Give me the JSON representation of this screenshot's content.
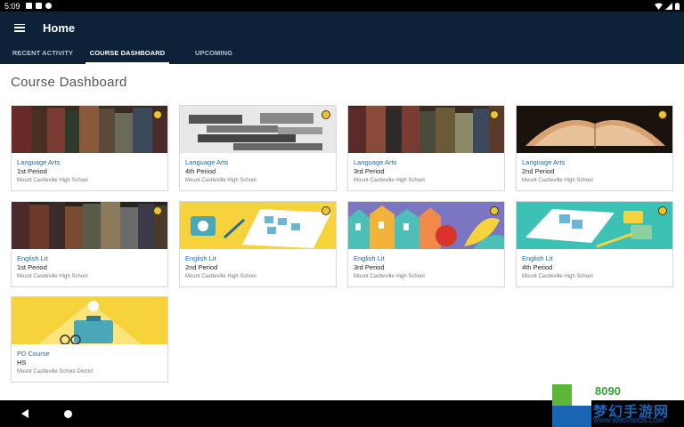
{
  "status_bar": {
    "time": "5:09"
  },
  "app_bar": {
    "title": "Home",
    "menu_icon": "hamburger-menu-icon"
  },
  "tabs": [
    {
      "label": "RECENT ACTIVITY",
      "active": false
    },
    {
      "label": "COURSE DASHBOARD",
      "active": true
    },
    {
      "label": "UPCOMING",
      "active": false
    }
  ],
  "page_title": "Course Dashboard",
  "courses": [
    {
      "course": "Language Arts",
      "section": "1st Period",
      "school": "Mount Castleville High School",
      "image": "books-spines"
    },
    {
      "course": "Language Arts",
      "section": "4th Period",
      "school": "Mount Castleville High School",
      "image": "books-stack-grayscale"
    },
    {
      "course": "Language Arts",
      "section": "3rd Period",
      "school": "Mount Castleville High School",
      "image": "books-spines"
    },
    {
      "course": "Language Arts",
      "section": "2nd Period",
      "school": "Mount Castleville High School",
      "image": "open-book"
    },
    {
      "course": "English Lit",
      "section": "1st Period",
      "school": "Mount Castleville High School",
      "image": "books-spines"
    },
    {
      "course": "English Lit",
      "section": "2nd Period",
      "school": "Mount Castleville High School",
      "image": "yellow-notebook-illustration"
    },
    {
      "course": "English Lit",
      "section": "3rd Period",
      "school": "Mount Castleville High School",
      "image": "houses-fruit-illustration"
    },
    {
      "course": "English Lit",
      "section": "4th Period",
      "school": "Mount Castleville High School",
      "image": "teal-notebook-illustration"
    },
    {
      "course": "PD Course",
      "section": "HS",
      "school": "Mount Castleville School District",
      "image": "lightbulb-briefcase-illustration"
    }
  ],
  "watermark": {
    "line1": "8090",
    "line2": "梦幻手游网",
    "line3": "WWW.8090VISION.COM"
  },
  "colors": {
    "app_bar": "#0d2238",
    "link": "#1c6aa8",
    "badge": "#f2c230"
  }
}
